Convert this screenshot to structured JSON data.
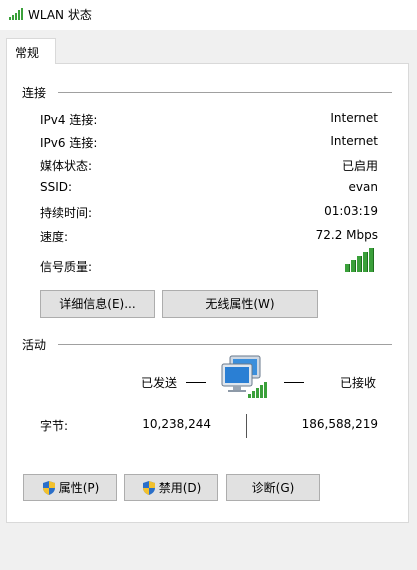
{
  "window": {
    "title": "WLAN 状态",
    "icon": "wifi-signal-icon"
  },
  "tabs": [
    {
      "label": "常规"
    }
  ],
  "connection": {
    "heading": "连接",
    "rows": [
      {
        "label": "IPv4 连接:",
        "value": "Internet"
      },
      {
        "label": "IPv6 连接:",
        "value": "Internet"
      },
      {
        "label": "媒体状态:",
        "value": "已启用"
      },
      {
        "label": "SSID:",
        "value": "evan"
      },
      {
        "label": "持续时间:",
        "value": "01:03:19"
      },
      {
        "label": "速度:",
        "value": "72.2 Mbps"
      }
    ],
    "signal_label": "信号质量:",
    "signal_bars": 5,
    "signal_color": "#3aa03a"
  },
  "buttons": {
    "details": "详细信息(E)...",
    "wireless_props": "无线属性(W)"
  },
  "activity": {
    "heading": "活动",
    "sent_label": "已发送",
    "received_label": "已接收",
    "bytes_label": "字节:",
    "bytes_sent": "10,238,244",
    "bytes_received": "186,588,219",
    "network_icon": "network-computers-icon"
  },
  "footer": {
    "properties": "属性(P)",
    "disable": "禁用(D)",
    "diagnose": "诊断(G)",
    "shield_icon": "uac-shield-icon"
  }
}
